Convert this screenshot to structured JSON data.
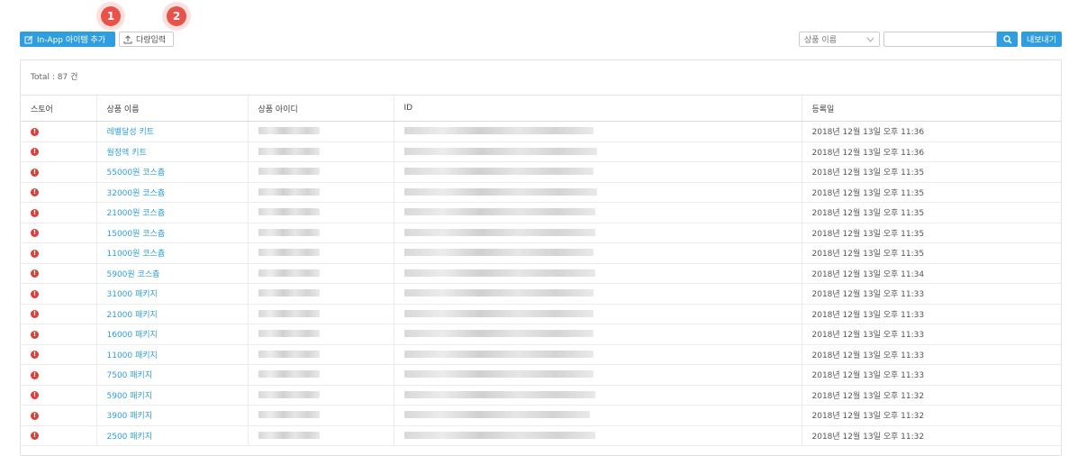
{
  "badges": [
    "1",
    "2"
  ],
  "toolbar": {
    "add_label": "In-App 아이템 추가",
    "bulk_label": "다량입력",
    "select_value": "상품 이름",
    "search_value": "",
    "export_label": "내보내기",
    "accent": "#2f9ee0"
  },
  "total": "Total : 87 건",
  "columns": [
    "스토어",
    "상품 이름",
    "상품 아이디",
    "ID",
    "등록일"
  ],
  "rows": [
    {
      "store": "!",
      "name": "레벨달성 키트",
      "date": "2018년 12월 13일 오후 11:36"
    },
    {
      "store": "!",
      "name": "월정액 키트",
      "date": "2018년 12월 13일 오후 11:36"
    },
    {
      "store": "!",
      "name": "55000원 코스츔",
      "date": "2018년 12월 13일 오후 11:35"
    },
    {
      "store": "!",
      "name": "32000원 코스츔",
      "date": "2018년 12월 13일 오후 11:35"
    },
    {
      "store": "!",
      "name": "21000원 코스츔",
      "date": "2018년 12월 13일 오후 11:35"
    },
    {
      "store": "!",
      "name": "15000원 코스츔",
      "date": "2018년 12월 13일 오후 11:35"
    },
    {
      "store": "!",
      "name": "11000원 코스츔",
      "date": "2018년 12월 13일 오후 11:35"
    },
    {
      "store": "!",
      "name": "5900원 코스츔",
      "date": "2018년 12월 13일 오후 11:34"
    },
    {
      "store": "!",
      "name": "31000 패키지",
      "date": "2018년 12월 13일 오후 11:33"
    },
    {
      "store": "!",
      "name": "21000 패키지",
      "date": "2018년 12월 13일 오후 11:33"
    },
    {
      "store": "!",
      "name": "16000 패키지",
      "date": "2018년 12월 13일 오후 11:33"
    },
    {
      "store": "!",
      "name": "11000 패키지",
      "date": "2018년 12월 13일 오후 11:33"
    },
    {
      "store": "!",
      "name": "7500 패키지",
      "date": "2018년 12월 13일 오후 11:33"
    },
    {
      "store": "!",
      "name": "5900 패키지",
      "date": "2018년 12월 13일 오후 11:32"
    },
    {
      "store": "!",
      "name": "3900 패키지",
      "date": "2018년 12월 13일 오후 11:32"
    },
    {
      "store": "!",
      "name": "2500 패키지",
      "date": "2018년 12월 13일 오후 11:32"
    }
  ]
}
